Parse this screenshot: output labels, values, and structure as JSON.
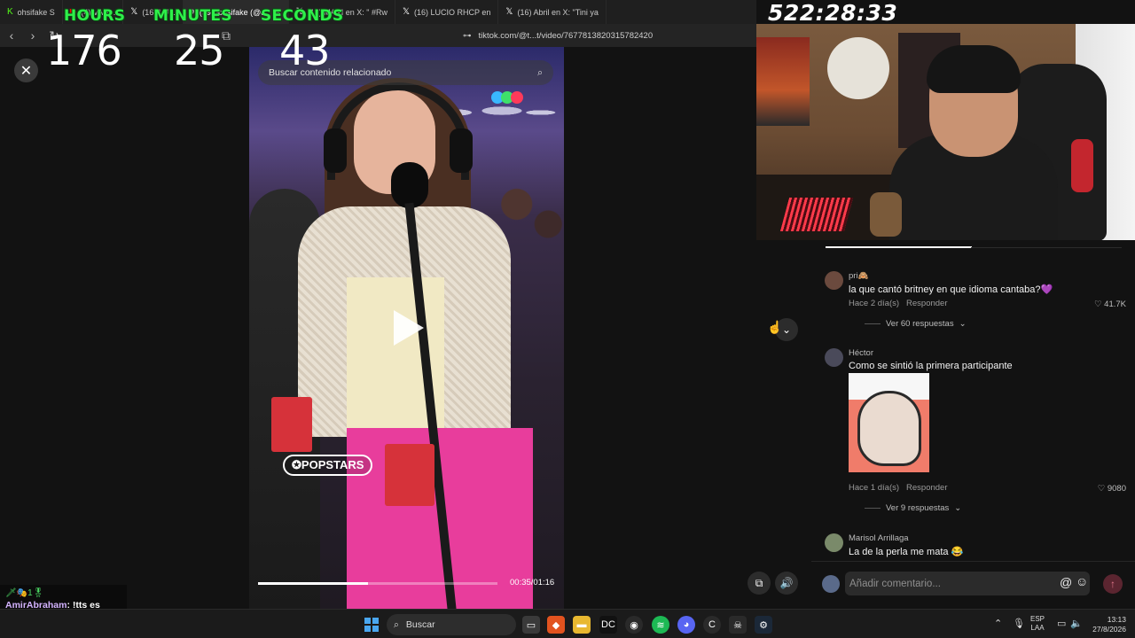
{
  "browser": {
    "tabs": [
      {
        "label": "ohsifake S",
        "icon": "kick-icon",
        "active": false
      },
      {
        "label": "(4) VAN...",
        "icon": "youtube-icon",
        "active": false
      },
      {
        "label": "(16) LU...",
        "icon": "x-icon",
        "active": false
      },
      {
        "label": "(99+)ohsifake (@o",
        "icon": "tiktok-icon",
        "active": true
      },
      {
        "label": "(16) MAXI en X: \" #Rw",
        "icon": "x-icon",
        "active": false
      },
      {
        "label": "(16) LUCIO RHCP en",
        "icon": "x-icon",
        "active": false
      },
      {
        "label": "(16) Abril en X: \"Tini ya",
        "icon": "x-icon",
        "active": false
      }
    ],
    "url": "tiktok.com/@t...t/video/7677813820315782420"
  },
  "countdown": {
    "hours_label": "HOURS",
    "minutes_label": "MINUTES",
    "seconds_label": "SECONDS",
    "hours": "176",
    "minutes": "25",
    "seconds": "43",
    "total": "522:28:33"
  },
  "video": {
    "search_placeholder": "Buscar contenido relacionado",
    "watermark": "POPSTARS",
    "time": "00:35/01:16",
    "progress": 0.46
  },
  "comments": [
    {
      "user": "pri🙈",
      "text": "la que cantó britney en que idioma cantaba?💜",
      "meta_time": "Hace 2 día(s)",
      "reply_label": "Responder",
      "likes": "41.7K",
      "replies": "Ver 60 respuestas",
      "avatar_color": "#6b4a3e"
    },
    {
      "user": "Héctor",
      "text": "Como se sintió la primera participante",
      "meta_time": "Hace 1 día(s)",
      "reply_label": "Responder",
      "likes": "9080",
      "replies": "Ver 9 respuestas",
      "avatar_color": "#4a4a5a"
    },
    {
      "user": "Marisol Arrillaga",
      "text": "La de la perla me mata 😂",
      "avatar_color": "#7a8a6a"
    }
  ],
  "comment_input": {
    "placeholder": "Añadir comentario..."
  },
  "chat": {
    "badges": "🗡🎭1🎖",
    "name": "AmirAbraham",
    "message": "!tts es ilegal saber cantar?"
  },
  "taskbar": {
    "search_label": "Buscar",
    "lang_top": "ESP",
    "lang_bottom": "LAA",
    "time": "13:13",
    "date": "27/8/2026"
  },
  "colors": {
    "timer_green": "#2ef04a",
    "accent_pink": "#fe2c55",
    "background": "#121212"
  }
}
